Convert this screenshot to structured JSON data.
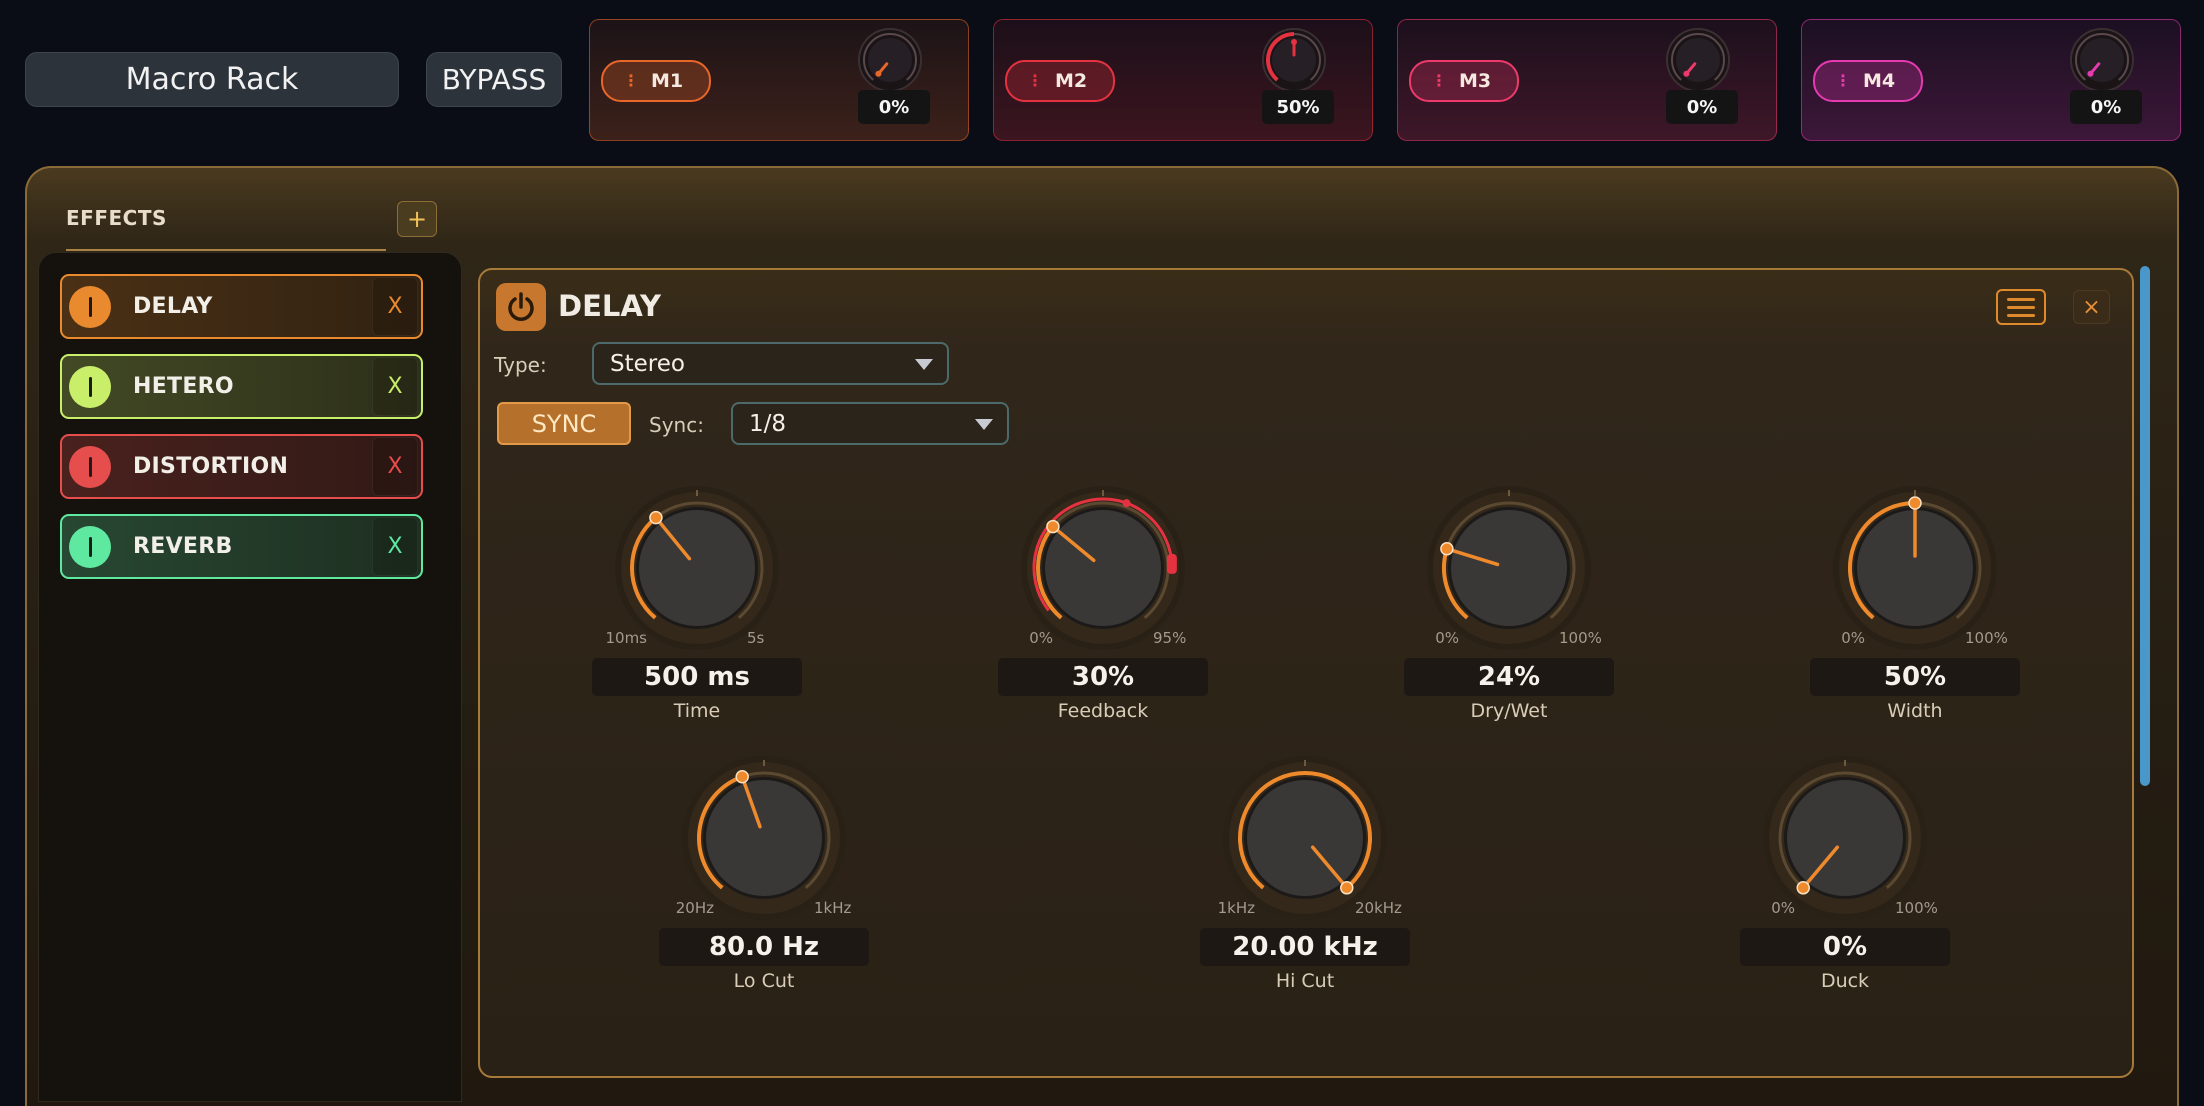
{
  "header": {
    "preset_name": "Macro Rack",
    "bypass_label": "BYPASS"
  },
  "macros": [
    {
      "label": "M1",
      "value": "0%",
      "fraction": 0.0,
      "color": "#e8662a"
    },
    {
      "label": "M2",
      "value": "50%",
      "fraction": 0.5,
      "color": "#e53240"
    },
    {
      "label": "M3",
      "value": "0%",
      "fraction": 0.0,
      "color": "#ee3a6a"
    },
    {
      "label": "M4",
      "value": "0%",
      "fraction": 0.0,
      "color": "#e63ab0"
    }
  ],
  "effects_panel": {
    "title": "EFFECTS",
    "add_label": "+",
    "items": [
      {
        "name": "DELAY",
        "remove": "X",
        "color": "#e98a2e"
      },
      {
        "name": "HETERO",
        "remove": "X",
        "color": "#c9ef6a"
      },
      {
        "name": "DISTORTION",
        "remove": "X",
        "color": "#e64d4d"
      },
      {
        "name": "REVERB",
        "remove": "X",
        "color": "#5ee8a0"
      }
    ]
  },
  "module": {
    "title": "DELAY",
    "close_label": "×",
    "type_label": "Type:",
    "type_value": "Stereo",
    "sync_button": "SYNC",
    "sync_label": "Sync:",
    "sync_value": "1/8",
    "knobs": [
      {
        "name": "Time",
        "value": "500 ms",
        "min": "10ms",
        "max": "5s",
        "fraction": 0.36
      },
      {
        "name": "Feedback",
        "value": "30%",
        "min": "0%",
        "max": "95%",
        "fraction": 0.32,
        "mod_fraction": 0.5
      },
      {
        "name": "Dry/Wet",
        "value": "24%",
        "min": "0%",
        "max": "100%",
        "fraction": 0.24
      },
      {
        "name": "Width",
        "value": "50%",
        "min": "0%",
        "max": "100%",
        "fraction": 0.5
      },
      {
        "name": "Lo Cut",
        "value": "80.0 Hz",
        "min": "20Hz",
        "max": "1kHz",
        "fraction": 0.43
      },
      {
        "name": "Hi Cut",
        "value": "20.00 kHz",
        "min": "1kHz",
        "max": "20kHz",
        "fraction": 1.0
      },
      {
        "name": "Duck",
        "value": "0%",
        "min": "0%",
        "max": "100%",
        "fraction": 0.0
      }
    ]
  }
}
